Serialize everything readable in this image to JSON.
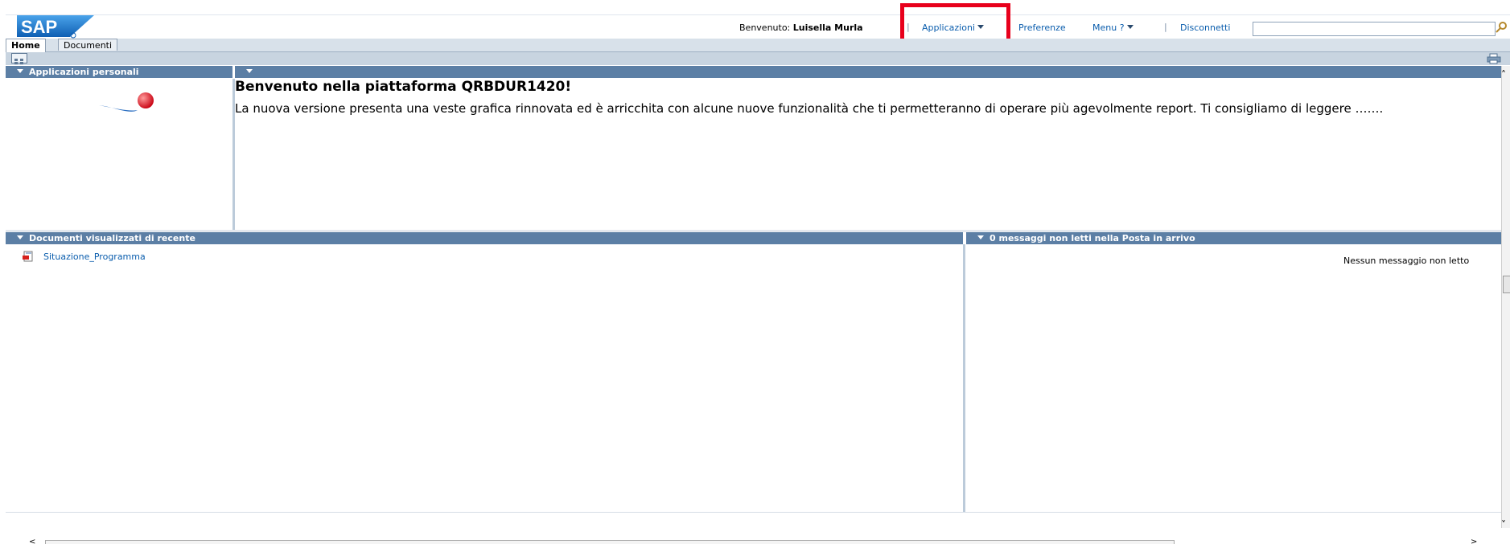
{
  "header": {
    "welcome_label": "Benvenuto:",
    "user_name": "Luisella Murla",
    "links": {
      "applicazioni": "Applicazioni",
      "preferenze": "Preferenze",
      "menu": "Menu ?",
      "disconnetti": "Disconnetti"
    },
    "separator": "|",
    "search_value": ""
  },
  "tabs": [
    {
      "label": "Home",
      "active": true
    },
    {
      "label": "Documenti",
      "active": false
    }
  ],
  "panels": {
    "personal_apps_title": "Applicazioni personali",
    "main": {
      "title": "Benvenuto nella piattaforma QRBDUR1420!",
      "text": "La nuova versione presenta una veste grafica rinnovata ed è arricchita con alcune nuove funzionalità che ti permetteranno di operare più agevolmente report. Ti consigliamo di leggere ……."
    },
    "recent_docs": {
      "title": "Documenti visualizzati di recente",
      "items": [
        "Situazione_Programma"
      ]
    },
    "inbox": {
      "title": "0 messaggi non letti nella Posta in arrivo",
      "empty_text": "Nessun messaggio non letto"
    }
  },
  "colors": {
    "panel_header": "#5c7fa5",
    "link": "#0a5dad",
    "highlight": "#e8001c"
  },
  "icons": [
    "sap-logo",
    "pushpin-icon",
    "grid-view-icon",
    "print-icon",
    "search-icon",
    "report-icon"
  ]
}
